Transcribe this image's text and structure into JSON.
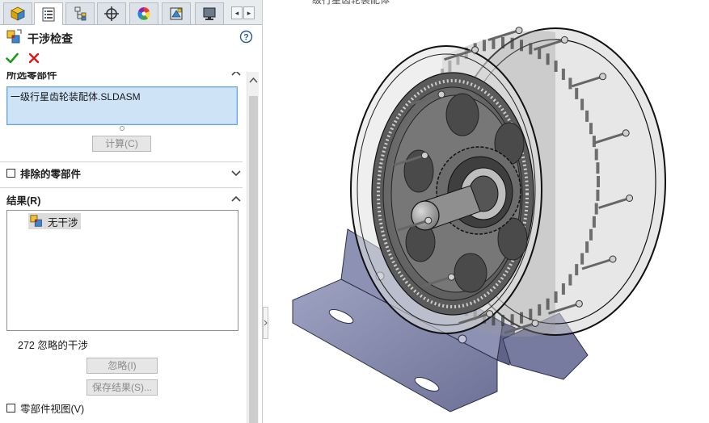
{
  "tabs": [
    {
      "name": "featuremanager-tab",
      "icon": "part-cube-icon",
      "active": false
    },
    {
      "name": "propertymanager-tab",
      "icon": "property-list-icon",
      "active": true
    },
    {
      "name": "configurationmanager-tab",
      "icon": "configuration-icon",
      "active": false
    },
    {
      "name": "dimxpert-tab",
      "icon": "crosshair-icon",
      "active": false
    },
    {
      "name": "appearance-tab",
      "icon": "color-wheel-icon",
      "active": false
    },
    {
      "name": "cam-tab",
      "icon": "cam-icon",
      "active": false
    },
    {
      "name": "display-tab",
      "icon": "display-icon",
      "active": false
    }
  ],
  "property_manager": {
    "title": "干涉检查",
    "ok_icon": "checkmark-icon",
    "cancel_icon": "close-icon"
  },
  "selected_components": {
    "heading": "所选零部件",
    "item": "一级行星齿轮装配体.SLDASM",
    "calculate_label": "计算(C)"
  },
  "excluded_components": {
    "label": "排除的零部件"
  },
  "results": {
    "heading": "结果(R)",
    "item": "无干涉",
    "ignored_count": "272 忽略的干涉",
    "ignore_label": "忽略(I)",
    "save_label": "保存结果(S)..."
  },
  "component_view": {
    "label": "零部件视图(V)"
  },
  "viewport": {
    "caption": "一级行星齿轮装配体"
  },
  "colors": {
    "ok_green": "#1b9a1b",
    "cancel_red": "#d11a1a",
    "selection_fill": "#cfe3f7",
    "selection_border": "#62a8e5"
  }
}
